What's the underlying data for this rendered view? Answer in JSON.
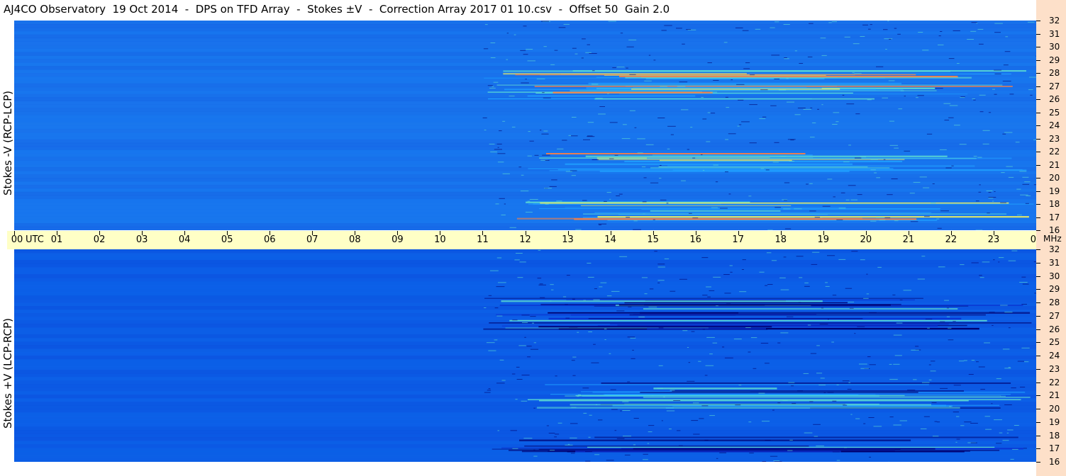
{
  "title": "AJ4CO Observatory  19 Oct 2014  -  DPS on TFD Array  -  Stokes ±V  -  Correction Array 2017 01 10.csv  -  Offset 50  Gain 2.0",
  "chart_data": [
    {
      "type": "heatmap",
      "panel": "top",
      "ylabel": "Stokes -V (RCP-LCP)",
      "x_unit": "UTC",
      "x_ticks": [
        "00",
        "01",
        "02",
        "03",
        "04",
        "05",
        "06",
        "07",
        "08",
        "09",
        "10",
        "11",
        "12",
        "13",
        "14",
        "15",
        "16",
        "17",
        "18",
        "19",
        "20",
        "21",
        "22",
        "23",
        "00"
      ],
      "xlim": [
        0,
        24
      ],
      "y_unit": "MHz",
      "y_ticks": [
        "16",
        "17",
        "18",
        "19",
        "20",
        "21",
        "22",
        "23",
        "24",
        "25",
        "26",
        "27",
        "28",
        "29",
        "30",
        "31",
        "32"
      ],
      "ylim": [
        16,
        32
      ],
      "colormap": [
        "#000070",
        "#0a2fd0",
        "#0c6cf0",
        "#20a0ff",
        "#60e0d0",
        "#f0f060",
        "#ff8040"
      ],
      "background_color": "#1a78ee",
      "features": [
        {
          "t0": 11.0,
          "t1": 24.0,
          "f0": 26.0,
          "f1": 28.5,
          "level": "bright"
        },
        {
          "t0": 11.5,
          "t1": 24.0,
          "f0": 16.8,
          "f1": 18.2,
          "level": "bright"
        },
        {
          "t0": 12.0,
          "t1": 24.0,
          "f0": 20.5,
          "f1": 22.0,
          "level": "bright"
        }
      ]
    },
    {
      "type": "heatmap",
      "panel": "bottom",
      "ylabel": "Stokes +V (LCP-RCP)",
      "x_unit": "UTC",
      "xlim": [
        0,
        24
      ],
      "y_unit": "MHz",
      "y_ticks": [
        "16",
        "17",
        "18",
        "19",
        "20",
        "21",
        "22",
        "23",
        "24",
        "25",
        "26",
        "27",
        "28",
        "29",
        "30",
        "31",
        "32"
      ],
      "ylim": [
        16,
        32
      ],
      "colormap": [
        "#000070",
        "#0a2fd0",
        "#0c6cf0",
        "#20a0ff",
        "#60e0d0",
        "#f0f060",
        "#ff8040"
      ],
      "background_color": "#0c5ee6",
      "features": [
        {
          "t0": 11.0,
          "t1": 24.0,
          "f0": 26.0,
          "f1": 28.5,
          "level": "dark"
        },
        {
          "t0": 11.0,
          "t1": 24.0,
          "f0": 16.8,
          "f1": 18.0,
          "level": "dark"
        },
        {
          "t0": 12.0,
          "t1": 24.0,
          "f0": 20.0,
          "f1": 22.0,
          "level": "mixed"
        }
      ]
    }
  ],
  "axis": {
    "utc_label": "UTC",
    "mhz_label": "MHz"
  }
}
